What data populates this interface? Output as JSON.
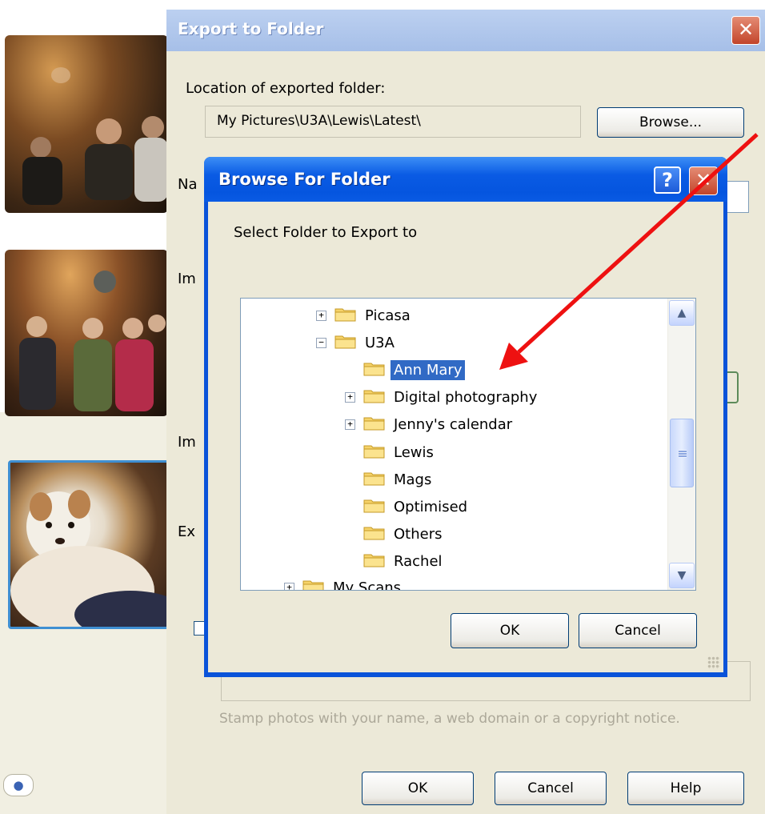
{
  "export_dialog": {
    "title": "Export to Folder",
    "close_symbol": "✕",
    "location_label": "Location of exported folder:",
    "location_value": "My Pictures\\U3A\\Lewis\\Latest\\",
    "browse_label": "Browse...",
    "partial_labels": [
      "Na",
      "Im",
      "Im",
      "Ex"
    ],
    "watermark_hint": "Stamp photos with your name, a web domain or a copyright notice.",
    "ok_label": "OK",
    "cancel_label": "Cancel",
    "help_label": "Help"
  },
  "browse_dialog": {
    "title": "Browse For Folder",
    "help_symbol": "?",
    "close_symbol": "✕",
    "prompt": "Select Folder to Export to",
    "tree": [
      {
        "label": "Picasa",
        "expander": "+",
        "level": 0
      },
      {
        "label": "U3A",
        "expander": "−",
        "level": 0
      },
      {
        "label": "Ann Mary",
        "expander": "",
        "level": 1,
        "selected": true
      },
      {
        "label": "Digital photography",
        "expander": "+",
        "level": 1
      },
      {
        "label": "Jenny's calendar",
        "expander": "+",
        "level": 1
      },
      {
        "label": "Lewis",
        "expander": "",
        "level": 1
      },
      {
        "label": "Mags",
        "expander": "",
        "level": 1
      },
      {
        "label": "Optimised",
        "expander": "",
        "level": 1
      },
      {
        "label": "Others",
        "expander": "",
        "level": 1
      },
      {
        "label": "Rachel",
        "expander": "",
        "level": 1
      },
      {
        "label": "My Scans",
        "expander": "+",
        "level": -1
      }
    ],
    "scroll_up_symbol": "▲",
    "scroll_down_symbol": "▼",
    "ok_label": "OK",
    "cancel_label": "Cancel"
  },
  "sidebar": {
    "people_icon": "person-icon"
  },
  "colors": {
    "selection": "#316ac5",
    "titlebar_blue": "#0a53d9",
    "arrow_red": "#ee1111"
  }
}
